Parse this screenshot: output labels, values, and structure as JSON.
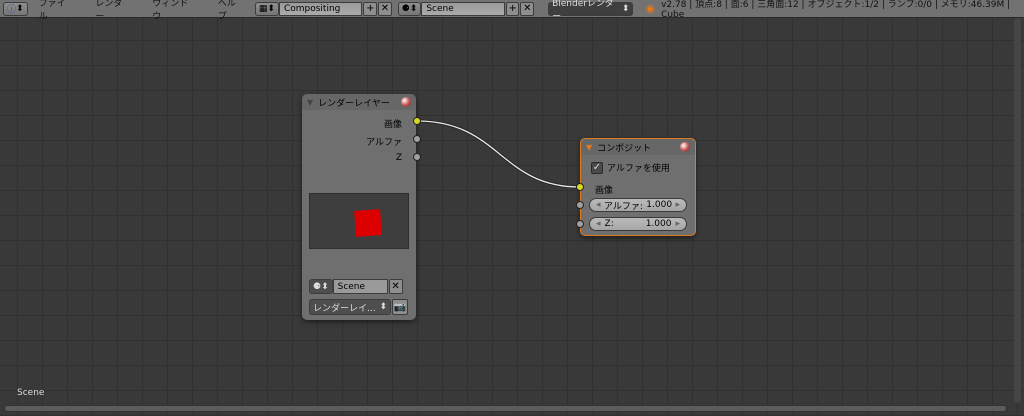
{
  "header": {
    "info_icon": "info-icon",
    "menus": [
      "ファイル",
      "レンダー",
      "ウィンドウ",
      "ヘルプ"
    ],
    "layout": "Compositing",
    "scene": "Scene",
    "engine": "Blenderレンダー",
    "status": "v2.78 | 頂点:8 | 面:6 | 三角面:12 | オブジェクト:1/2 | ランプ:0/0 | メモリ:46.39M | Cube"
  },
  "render_layers_node": {
    "title": "レンダーレイヤー",
    "outputs": [
      "画像",
      "アルファ",
      "Z"
    ],
    "scene": "Scene",
    "layer": "レンダーレイ..."
  },
  "composite_node": {
    "title": "コンポジット",
    "use_alpha_label": "アルファを使用",
    "use_alpha": true,
    "input_image": "画像",
    "alpha_label": "アルファ:",
    "alpha_value": "1.000",
    "z_label": "Z:",
    "z_value": "1.000"
  },
  "footer": {
    "scene_label": "Scene"
  },
  "colors": {
    "accent": "#e07a1f",
    "socket_image": "#d8d820",
    "preview": "#dd0000"
  }
}
